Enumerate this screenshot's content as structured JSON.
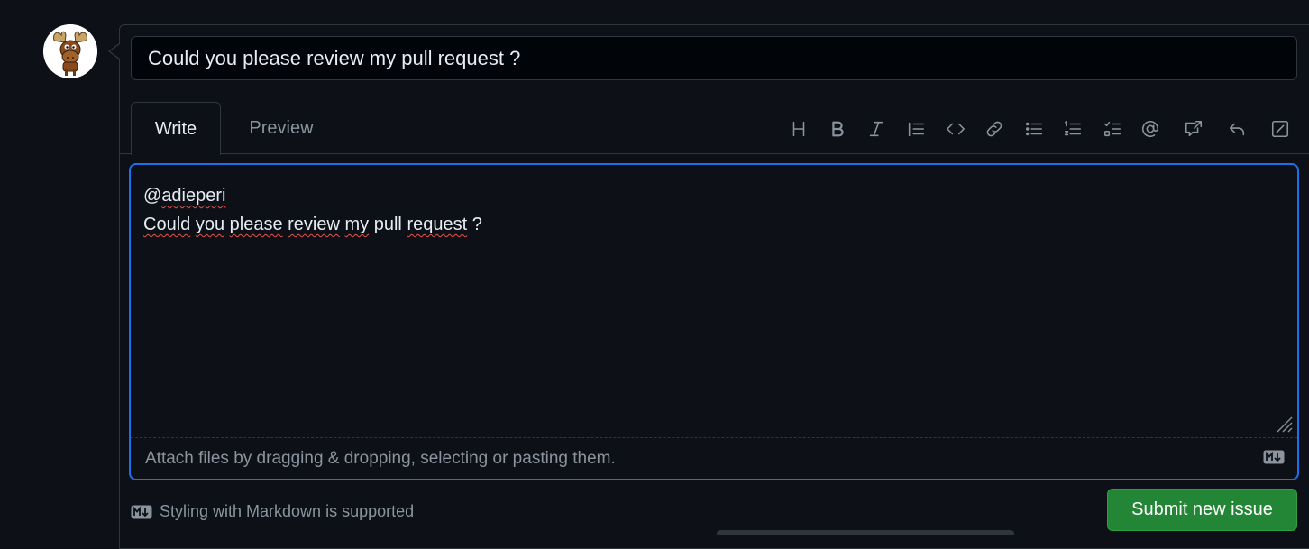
{
  "issue": {
    "title_value": "Could you please review my pull request ?"
  },
  "tabs": {
    "write": "Write",
    "preview": "Preview"
  },
  "toolbar": {
    "icons": [
      "heading-icon",
      "bold-icon",
      "italic-icon",
      "quote-icon",
      "code-icon",
      "link-icon",
      "unordered-list-icon",
      "ordered-list-icon",
      "task-list-icon",
      "mention-icon",
      "reference-icon",
      "undo-icon",
      "fullscreen-icon"
    ]
  },
  "editor": {
    "line1": "@adieperi",
    "line2_words": [
      "Could",
      "you",
      "please",
      "review",
      "my",
      "pull",
      "request",
      "?"
    ]
  },
  "attach": {
    "text": "Attach files by dragging & dropping, selecting or pasting them."
  },
  "footer": {
    "markdown_note": "Styling with Markdown is supported",
    "submit_label": "Submit new issue"
  },
  "colors": {
    "background": "#0d1117",
    "border": "#30363d",
    "focus": "#1f6feb",
    "submit": "#238636",
    "muted": "#8b949e"
  }
}
